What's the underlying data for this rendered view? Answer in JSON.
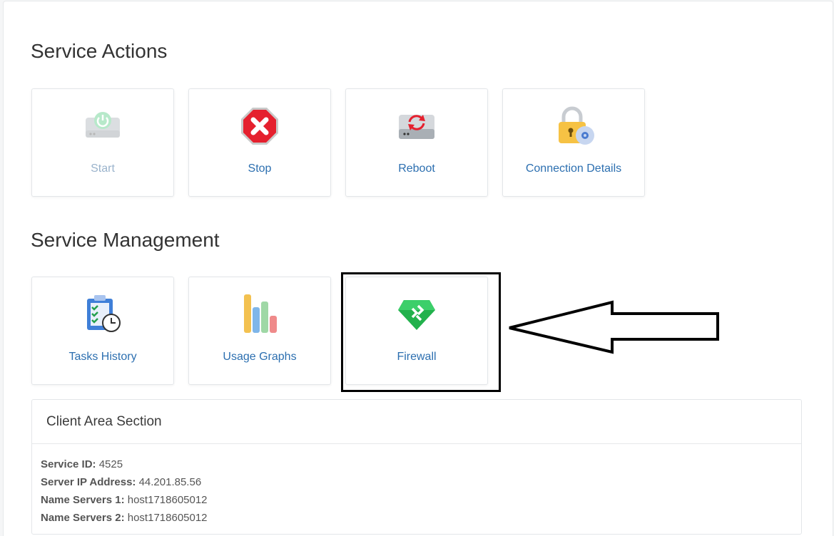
{
  "service_actions": {
    "title": "Service Actions",
    "tiles": [
      {
        "label": "Start",
        "icon": "power-drive-icon",
        "enabled": false
      },
      {
        "label": "Stop",
        "icon": "stop-sign-icon",
        "enabled": true
      },
      {
        "label": "Reboot",
        "icon": "reboot-drive-icon",
        "enabled": true
      },
      {
        "label": "Connection Details",
        "icon": "padlock-gear-icon",
        "enabled": true
      }
    ]
  },
  "service_management": {
    "title": "Service Management",
    "tiles": [
      {
        "label": "Tasks History",
        "icon": "clipboard-clock-icon"
      },
      {
        "label": "Usage Graphs",
        "icon": "bar-stack-icon"
      },
      {
        "label": "Firewall",
        "icon": "gem-shield-icon"
      }
    ]
  },
  "client_area": {
    "title": "Client Area Section",
    "rows": [
      {
        "key": "Service ID:",
        "value": "4525"
      },
      {
        "key": "Server IP Address:",
        "value": "44.201.85.56"
      },
      {
        "key": "Name Servers 1:",
        "value": "host1718605012"
      },
      {
        "key": "Name Servers 2:",
        "value": "host1718605012"
      }
    ]
  },
  "colors": {
    "link": "#2c6fb0",
    "disabled_link": "#9ab3cc",
    "stop_red": "#e5202e",
    "firewall_green": "#22b14c"
  }
}
